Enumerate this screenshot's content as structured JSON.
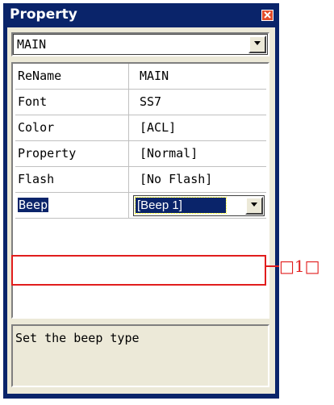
{
  "window": {
    "title": "Property"
  },
  "combo": {
    "value": "MAIN"
  },
  "grid": {
    "rows": [
      {
        "name": "ReName",
        "value": "MAIN"
      },
      {
        "name": "Font",
        "value": "SS7"
      },
      {
        "name": "Color",
        "value": "[ACL]"
      },
      {
        "name": "Property",
        "value": "[Normal]"
      },
      {
        "name": "Flash",
        "value": "[No Flash]"
      }
    ],
    "selected": {
      "name": "Beep",
      "value": "[Beep 1]"
    }
  },
  "description": {
    "text": "Set the beep type"
  },
  "callout": {
    "label": "□1□"
  },
  "colors": {
    "titlebar": "#0a246a",
    "highlight": "#e11d1d",
    "panel": "#ece9d8"
  },
  "icons": {
    "close": "close-icon",
    "dropdown": "chevron-down-icon"
  }
}
